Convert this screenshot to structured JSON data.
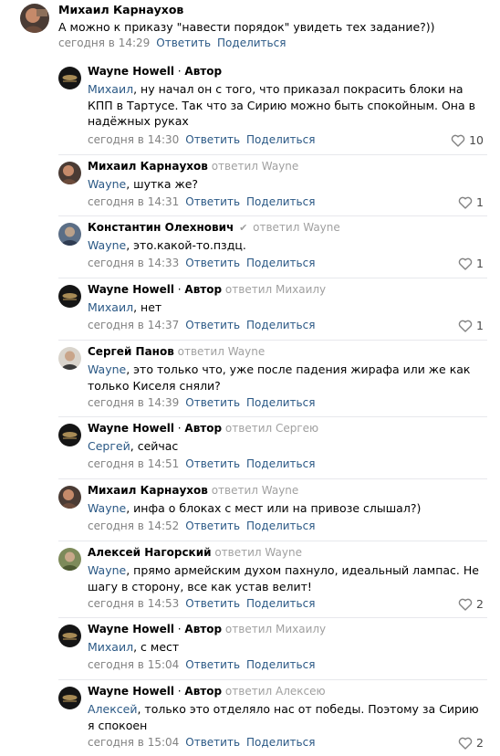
{
  "top_comment": {
    "author": "Михаил Карнаухов",
    "text": "А можно к приказу \"навести порядок\" увидеть тех задание?))",
    "time": "сегодня в 14:29",
    "reply_label": "Ответить",
    "share_label": "Поделиться",
    "avatar_icon": "avatar-mikhail-icon"
  },
  "replies": [
    {
      "author": "Wayne Howell",
      "role": "Автор",
      "replied_to": "",
      "mention": "Михаил",
      "text": ", ну начал он с того, что приказал покрасить блоки на КПП в Тартусе. Так что за Сирию можно быть спокойным. Она в надёжных руках",
      "time": "сегодня в 14:30",
      "reply_label": "Ответить",
      "share_label": "Поделиться",
      "likes": "10"
    },
    {
      "author": "Михаил Карнаухов",
      "role": "",
      "replied_to": "ответил Wayne",
      "mention": "Wayne",
      "text": ", шутка же?",
      "time": "сегодня в 14:31",
      "reply_label": "Ответить",
      "share_label": "Поделиться",
      "likes": "1"
    },
    {
      "author": "Константин Олехнович",
      "role": "",
      "replied_to": "ответил Wayne",
      "verified": true,
      "mention": "Wayne",
      "text": ", это.какой-то.пздц.",
      "time": "сегодня в 14:33",
      "reply_label": "Ответить",
      "share_label": "Поделиться",
      "likes": "1"
    },
    {
      "author": "Wayne Howell",
      "role": "Автор",
      "replied_to": "ответил Михаилу",
      "mention": "Михаил",
      "text": ", нет",
      "time": "сегодня в 14:37",
      "reply_label": "Ответить",
      "share_label": "Поделиться",
      "likes": "1"
    },
    {
      "author": "Сергей Панов",
      "role": "",
      "replied_to": "ответил Wayne",
      "mention": "Wayne",
      "text": ", это только что, уже после падения жирафа или же как только Киселя сняли?",
      "time": "сегодня в 14:39",
      "reply_label": "Ответить",
      "share_label": "Поделиться",
      "likes": ""
    },
    {
      "author": "Wayne Howell",
      "role": "Автор",
      "replied_to": "ответил Сергею",
      "mention": "Сергей",
      "text": ", сейчас",
      "time": "сегодня в 14:51",
      "reply_label": "Ответить",
      "share_label": "Поделиться",
      "likes": ""
    },
    {
      "author": "Михаил Карнаухов",
      "role": "",
      "replied_to": "ответил Wayne",
      "mention": "Wayne",
      "text": ", инфа о блоках с мест или на привозе слышал?)",
      "time": "сегодня в 14:52",
      "reply_label": "Ответить",
      "share_label": "Поделиться",
      "likes": ""
    },
    {
      "author": "Алексей Нагорский",
      "role": "",
      "replied_to": "ответил Wayne",
      "mention": "Wayne",
      "text": ", прямо армейским духом пахнуло, идеальный лампас. Не шагу в сторону, все как устав велит!",
      "time": "сегодня в 14:53",
      "reply_label": "Ответить",
      "share_label": "Поделиться",
      "likes": "2"
    },
    {
      "author": "Wayne Howell",
      "role": "Автор",
      "replied_to": "ответил Михаилу",
      "mention": "Михаил",
      "text": ", с мест",
      "time": "сегодня в 15:04",
      "reply_label": "Ответить",
      "share_label": "Поделиться",
      "likes": ""
    },
    {
      "author": "Wayne Howell",
      "role": "Автор",
      "replied_to": "ответил Алексею",
      "mention": "Алексей",
      "text": ", только это отделяло нас от победы. Поэтому за Сирию я спокоен",
      "time": "сегодня в 15:04",
      "reply_label": "Ответить",
      "share_label": "Поделиться",
      "likes": "2"
    }
  ],
  "colors": {
    "link": "#2a5885",
    "meta": "#828282",
    "replied": "#a0a0a0",
    "divider": "#e7e8ec"
  }
}
